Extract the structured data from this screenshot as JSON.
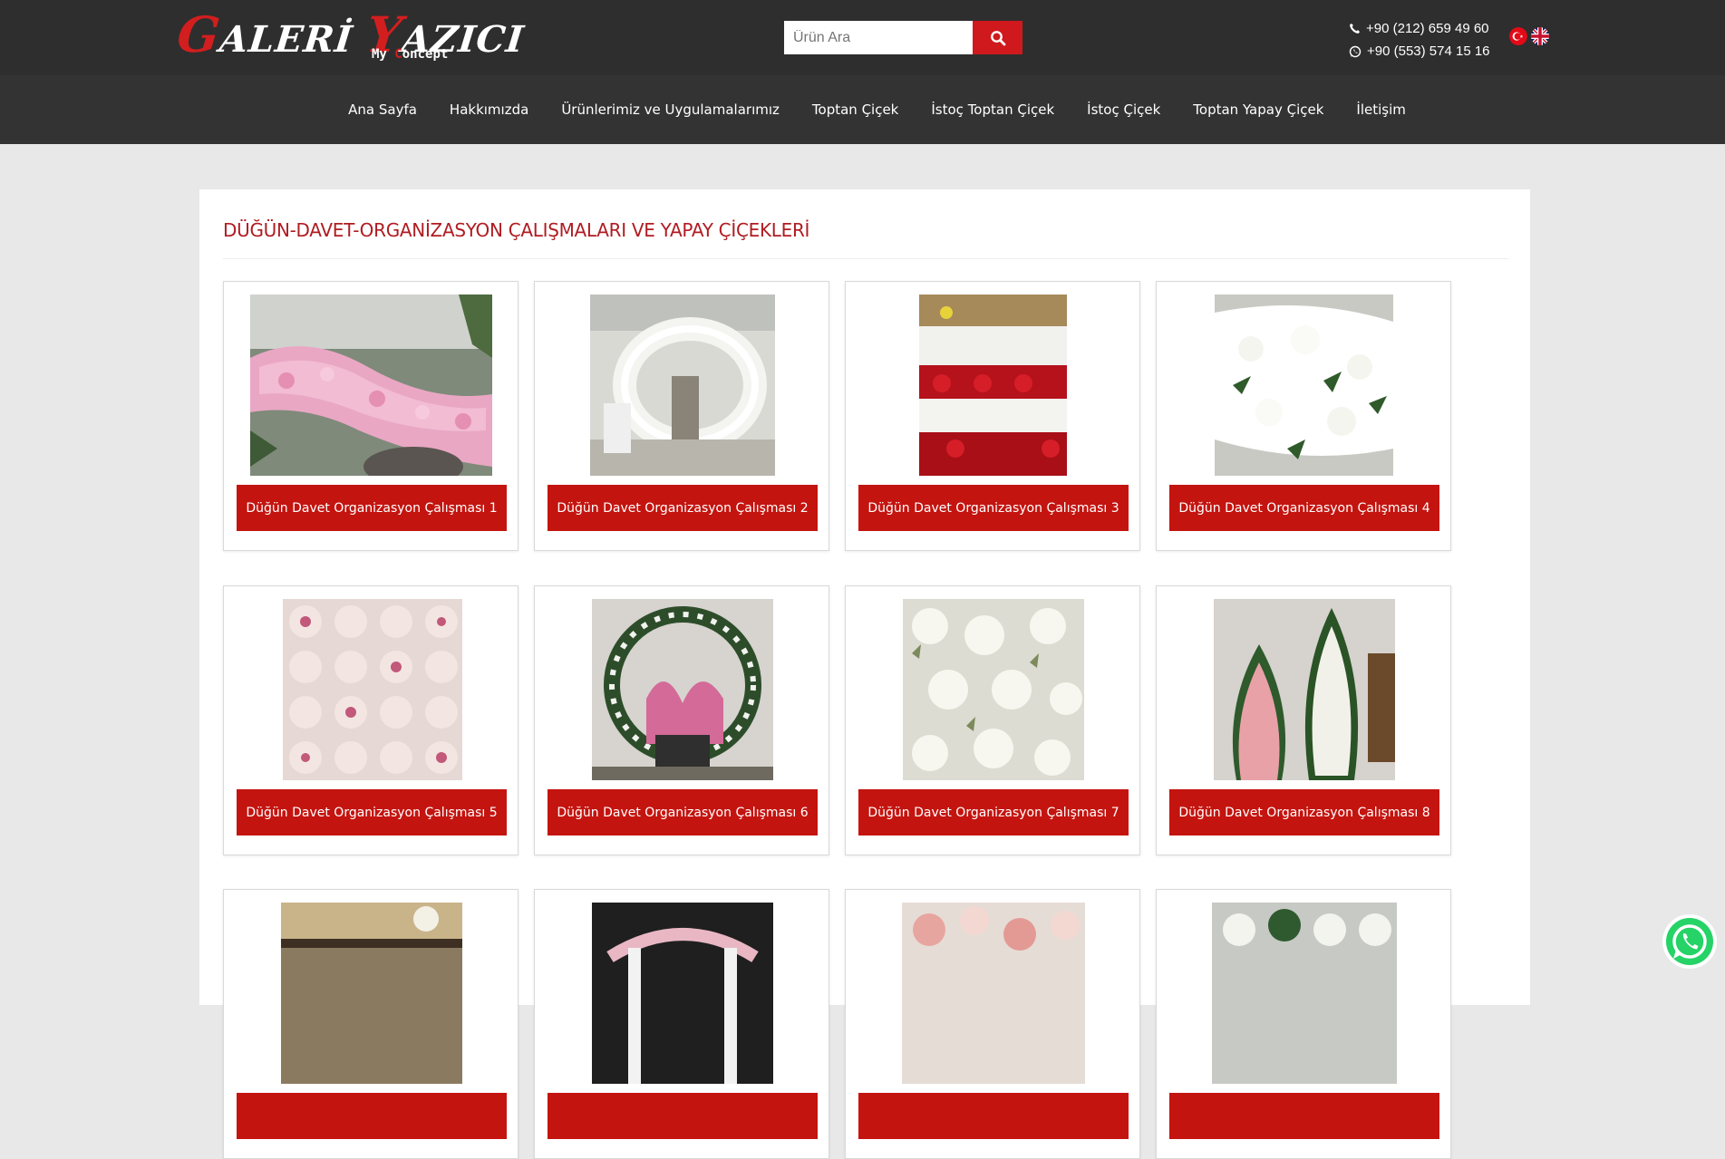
{
  "brand": {
    "logo_cap1": "G",
    "logo_rest1": "ALERİ ",
    "logo_cap2": "Y",
    "logo_rest2": "AZICI",
    "sub_1": "My ",
    "sub_2": "C",
    "sub_3": "oncept"
  },
  "search": {
    "placeholder": "Ürün Ara",
    "icon": "search-icon"
  },
  "contact": {
    "phone": "+90 (212) 659 49 60",
    "whatsapp": "+90 (553) 574 15 16"
  },
  "languages": [
    {
      "icon": "turkey-flag-icon"
    },
    {
      "icon": "uk-flag-icon"
    }
  ],
  "nav": [
    "Ana Sayfa",
    "Hakkımızda",
    "Ürünlerimiz ve Uygulamalarımız",
    "Toptan Çiçek",
    "İstoç Toptan Çiçek",
    "İstoç Çiçek",
    "Toptan Yapay Çiçek",
    "İletişim"
  ],
  "page": {
    "title": "DÜĞÜN-DAVET-ORGANİZASYON ÇALIŞMALARI VE YAPAY ÇİÇEKLERİ",
    "products": [
      {
        "label": "Düğün Davet Organizasyon Çalışması 1"
      },
      {
        "label": "Düğün Davet Organizasyon Çalışması 2"
      },
      {
        "label": "Düğün Davet Organizasyon Çalışması 3"
      },
      {
        "label": "Düğün Davet Organizasyon Çalışması 4"
      },
      {
        "label": "Düğün Davet Organizasyon Çalışması 5"
      },
      {
        "label": "Düğün Davet Organizasyon Çalışması 6"
      },
      {
        "label": "Düğün Davet Organizasyon Çalışması 7"
      },
      {
        "label": "Düğün Davet Organizasyon Çalışması 8"
      },
      {
        "label": ""
      },
      {
        "label": ""
      },
      {
        "label": ""
      },
      {
        "label": ""
      }
    ]
  },
  "colors": {
    "accent": "#c4140f",
    "header_bg": "#2e2e2e",
    "nav_bg": "#333333",
    "title": "#b01c22"
  },
  "floating": {
    "icon": "whatsapp-icon"
  }
}
